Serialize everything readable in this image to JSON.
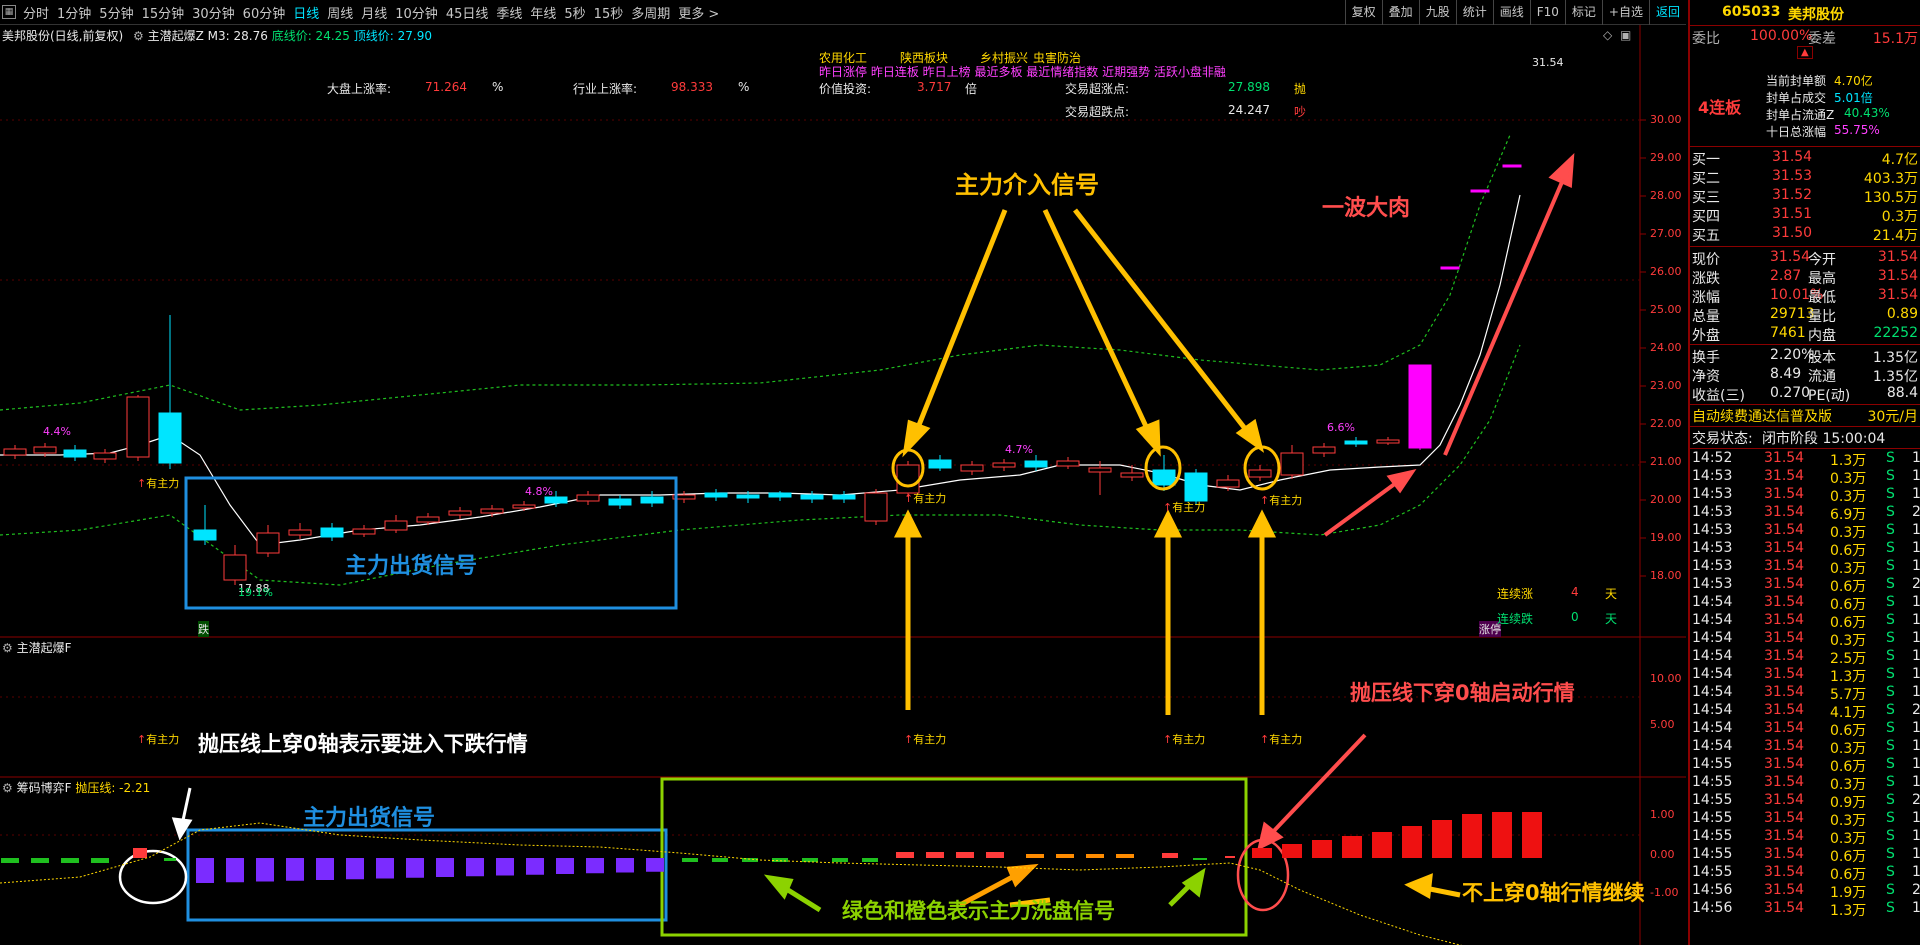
{
  "toolbar": {
    "periods": [
      "分时",
      "1分钟",
      "5分钟",
      "15分钟",
      "30分钟",
      "60分钟",
      "日线",
      "周线",
      "月线",
      "10分钟",
      "45日线",
      "季线",
      "年线",
      "5秒",
      "15秒",
      "多周期",
      "更多 >"
    ],
    "active_period": "日线",
    "right_buttons": [
      "复权",
      "叠加",
      "九股",
      "统计",
      "画线",
      "F10",
      "标记",
      "+自选",
      "返回"
    ],
    "right_active": "返回"
  },
  "header": {
    "title": "美邦股份(日线,前复权)",
    "indicator": "主潜起爆Z",
    "m3": "M3: 28.76",
    "bottom_line": "底线价: 24.25",
    "top_line": "顶线价: 27.90"
  },
  "stats": {
    "market_up_label": "大盘上涨率:",
    "market_up_value": "71.264",
    "market_up_unit": "%",
    "industry_up_label": "行业上涨率:",
    "industry_up_value": "98.333",
    "industry_up_unit": "%",
    "value_label": "价值投资:",
    "value_value": "3.717",
    "value_unit": "倍",
    "overbuy_label": "交易超涨点:",
    "overbuy_value": "27.898",
    "overbuy_tag": "抛",
    "oversell_label": "交易超跌点:",
    "oversell_value": "24.247",
    "oversell_tag": "吵"
  },
  "concepts": {
    "line1": [
      "农用化工",
      "陕西板块",
      "乡村振兴",
      "虫害防治"
    ],
    "line2": "昨日涨停 昨日连板 昨日上榜 最近多板 最近情绪指数 近期强势 活跃小盘非融"
  },
  "price_axis": [
    "30.00",
    "29.00",
    "28.00",
    "27.00",
    "26.00",
    "25.00",
    "24.00",
    "23.00",
    "22.00",
    "21.00",
    "20.00",
    "19.00",
    "18.00"
  ],
  "ind_axis": [
    "10.00",
    "5.00"
  ],
  "bottom_axis": [
    "1.00",
    "0.00",
    "-1.00"
  ],
  "chart_labels": {
    "high_price": "31.54",
    "low_price": "17.88",
    "low_pct": "19.1%",
    "pct_1": "4.4%",
    "pct_2": "4.8%",
    "pct_3": "4.7%",
    "pct_4": "6.6%",
    "zhuli": "有主力",
    "die": "跌",
    "zhangting": "涨停",
    "lianxu_zhang_label": "连续涨",
    "lianxu_zhang_value": "4",
    "lianxu_zhang_unit": "天",
    "lianxu_die_label": "连续跌",
    "lianxu_die_value": "0",
    "lianxu_die_unit": "天",
    "sub1_title": "主潜起爆F",
    "sub2_title": "筹码博弈F",
    "sub2_line": "抛压线: -2.21"
  },
  "annotations": {
    "main_entry": "主力介入信号",
    "big_wave": "一波大肉",
    "ship_signal_1": "主力出货信号",
    "ship_signal_2": "主力出货信号",
    "cross_up": "抛压线上穿0轴表示要进入下跌行情",
    "cross_down": "抛压线下穿0轴启动行情",
    "wash": "绿色和橙色表示主力洗盘信号",
    "continue": "不上穿0轴行情继续"
  },
  "panel": {
    "code": "605033",
    "name": "美邦股份",
    "wb_label": "委比",
    "wb_value": "100.00%",
    "wc_label": "委差",
    "wc_value": "15.1万",
    "lianban": "4连板",
    "info": [
      {
        "label": "当前封单额",
        "value": "4.70亿"
      },
      {
        "label": "封单占成交",
        "value": "5.01倍"
      },
      {
        "label": "封单占流通Z",
        "value": "40.43%"
      },
      {
        "label": "十日总涨幅",
        "value": "55.75%"
      }
    ],
    "buy": [
      {
        "label": "买一",
        "price": "31.54",
        "vol": "4.7亿"
      },
      {
        "label": "买二",
        "price": "31.53",
        "vol": "403.3万"
      },
      {
        "label": "买三",
        "price": "31.52",
        "vol": "130.5万"
      },
      {
        "label": "买四",
        "price": "31.51",
        "vol": "0.3万"
      },
      {
        "label": "买五",
        "price": "31.50",
        "vol": "21.4万"
      }
    ],
    "quote": [
      {
        "l1": "现价",
        "v1": "31.54",
        "l2": "今开",
        "v2": "31.54"
      },
      {
        "l1": "涨跌",
        "v1": "2.87",
        "l2": "最高",
        "v2": "31.54"
      },
      {
        "l1": "涨幅",
        "v1": "10.01%",
        "l2": "最低",
        "v2": "31.54"
      },
      {
        "l1": "总量",
        "v1": "29713",
        "l2": "量比",
        "v2": "0.89"
      },
      {
        "l1": "外盘",
        "v1": "7461",
        "l2": "内盘",
        "v2": "22252"
      }
    ],
    "fund": [
      {
        "l1": "换手",
        "v1": "2.20%",
        "l2": "股本",
        "v2": "1.35亿"
      },
      {
        "l1": "净资",
        "v1": "8.49",
        "l2": "流通",
        "v2": "1.35亿"
      },
      {
        "l1": "收益(三)",
        "v1": "0.270",
        "l2": "PE(动)",
        "v2": "88.4"
      }
    ],
    "ad": "自动续费通达信普及版",
    "ad_price": "30元/月",
    "status_label": "交易状态:",
    "status_value": "闭市阶段 15:00:04",
    "ticks": [
      [
        "14:52",
        "31.54",
        "1.3万",
        "S",
        "1"
      ],
      [
        "14:53",
        "31.54",
        "0.3万",
        "S",
        "1"
      ],
      [
        "14:53",
        "31.54",
        "0.3万",
        "S",
        "1"
      ],
      [
        "14:53",
        "31.54",
        "6.9万",
        "S",
        "2"
      ],
      [
        "14:53",
        "31.54",
        "0.3万",
        "S",
        "1"
      ],
      [
        "14:53",
        "31.54",
        "0.6万",
        "S",
        "1"
      ],
      [
        "14:53",
        "31.54",
        "0.3万",
        "S",
        "1"
      ],
      [
        "14:53",
        "31.54",
        "0.6万",
        "S",
        "2"
      ],
      [
        "14:54",
        "31.54",
        "0.6万",
        "S",
        "1"
      ],
      [
        "14:54",
        "31.54",
        "0.6万",
        "S",
        "1"
      ],
      [
        "14:54",
        "31.54",
        "0.3万",
        "S",
        "1"
      ],
      [
        "14:54",
        "31.54",
        "2.5万",
        "S",
        "1"
      ],
      [
        "14:54",
        "31.54",
        "1.3万",
        "S",
        "1"
      ],
      [
        "14:54",
        "31.54",
        "5.7万",
        "S",
        "1"
      ],
      [
        "14:54",
        "31.54",
        "4.1万",
        "S",
        "2"
      ],
      [
        "14:54",
        "31.54",
        "0.6万",
        "S",
        "1"
      ],
      [
        "14:54",
        "31.54",
        "0.3万",
        "S",
        "1"
      ],
      [
        "14:55",
        "31.54",
        "0.6万",
        "S",
        "1"
      ],
      [
        "14:55",
        "31.54",
        "0.3万",
        "S",
        "1"
      ],
      [
        "14:55",
        "31.54",
        "0.9万",
        "S",
        "2"
      ],
      [
        "14:55",
        "31.54",
        "0.3万",
        "S",
        "1"
      ],
      [
        "14:55",
        "31.54",
        "0.3万",
        "S",
        "1"
      ],
      [
        "14:55",
        "31.54",
        "0.6万",
        "S",
        "1"
      ],
      [
        "14:55",
        "31.54",
        "0.6万",
        "S",
        "1"
      ],
      [
        "14:56",
        "31.54",
        "1.9万",
        "S",
        "2"
      ],
      [
        "14:56",
        "31.54",
        "1.3万",
        "S",
        "1"
      ]
    ]
  },
  "colors": {
    "up": "#ff3b3b",
    "down": "#00e5ff",
    "ma": "#ffffff",
    "band": "#1fbf1f",
    "annotation_yellow": "#ffc000",
    "annotation_red": "#ff4d4d",
    "annotation_blue": "#1f8fe0",
    "box_blue": "#1f8fe0",
    "box_green": "#8cd200",
    "purple": "#7b2cff",
    "magenta": "#ff00ff"
  }
}
